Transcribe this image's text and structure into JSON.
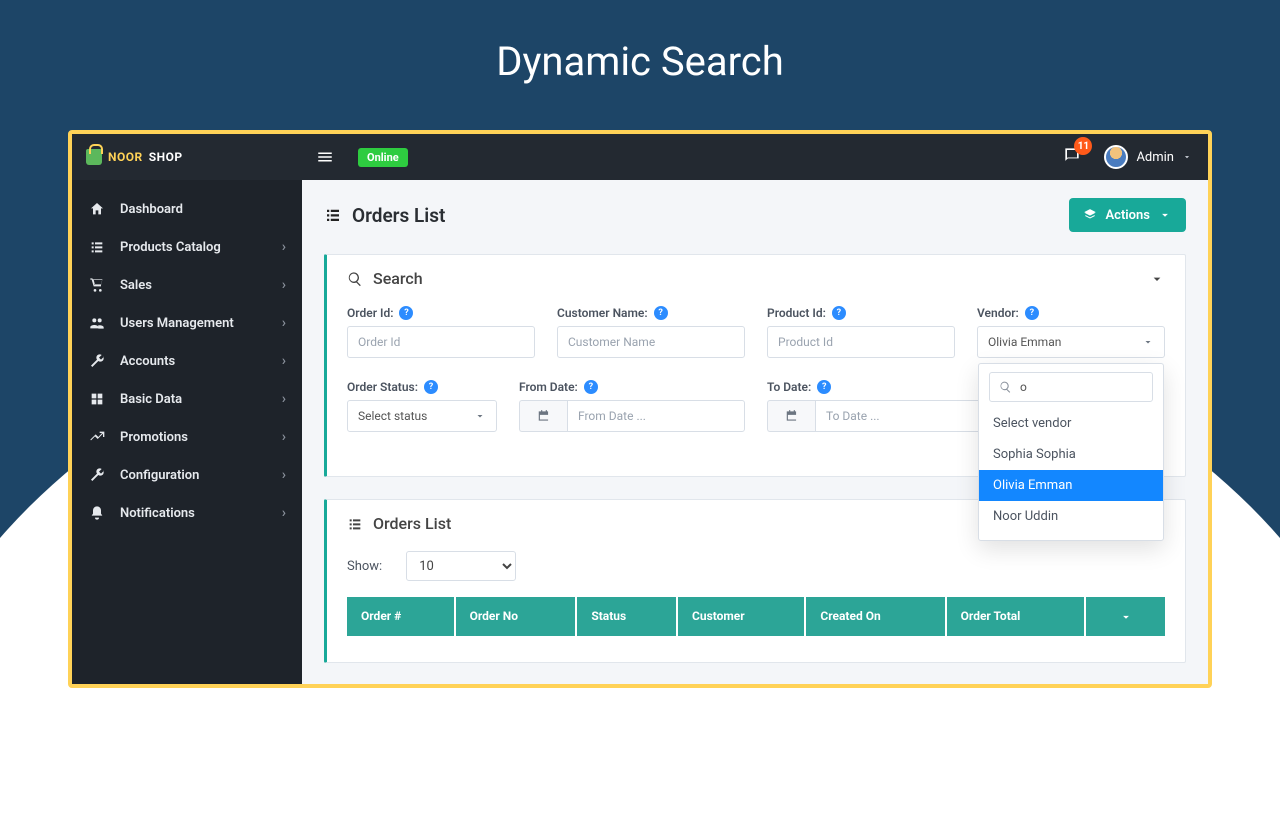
{
  "hero": "Dynamic Search",
  "brand": {
    "part1": "NOOR",
    "part2": "SHOP"
  },
  "topbar": {
    "status": "Online",
    "notif_count": "11",
    "username": "Admin"
  },
  "sidebar": {
    "items": [
      {
        "label": "Dashboard",
        "expandable": false
      },
      {
        "label": "Products Catalog",
        "expandable": true
      },
      {
        "label": "Sales",
        "expandable": true
      },
      {
        "label": "Users Management",
        "expandable": true
      },
      {
        "label": "Accounts",
        "expandable": true
      },
      {
        "label": "Basic Data",
        "expandable": true
      },
      {
        "label": "Promotions",
        "expandable": true
      },
      {
        "label": "Configuration",
        "expandable": true
      },
      {
        "label": "Notifications",
        "expandable": true
      }
    ]
  },
  "page": {
    "title": "Orders List",
    "actions_label": "Actions"
  },
  "search": {
    "title": "Search",
    "fields": {
      "order_id": {
        "label": "Order Id:",
        "placeholder": "Order Id"
      },
      "customer": {
        "label": "Customer Name:",
        "placeholder": "Customer Name"
      },
      "product_id": {
        "label": "Product Id:",
        "placeholder": "Product Id"
      },
      "vendor": {
        "label": "Vendor:",
        "selected": "Olivia Emman",
        "search_value": "o",
        "options": [
          "Select vendor",
          "Sophia Sophia",
          "Olivia Emman",
          "Noor Uddin"
        ]
      },
      "status": {
        "label": "Order Status:",
        "selected": "Select status"
      },
      "from_date": {
        "label": "From Date:",
        "placeholder": "From Date ..."
      },
      "to_date": {
        "label": "To Date:",
        "placeholder": "To Date ..."
      }
    }
  },
  "list": {
    "title": "Orders List",
    "show_label": "Show:",
    "show_value": "10",
    "columns": [
      "Order #",
      "Order No",
      "Status",
      "Customer",
      "Created On",
      "Order Total",
      ""
    ]
  },
  "chart_data": {
    "type": "table",
    "columns": [
      "Order #",
      "Order No",
      "Status",
      "Customer",
      "Created On",
      "Order Total"
    ],
    "rows": []
  }
}
